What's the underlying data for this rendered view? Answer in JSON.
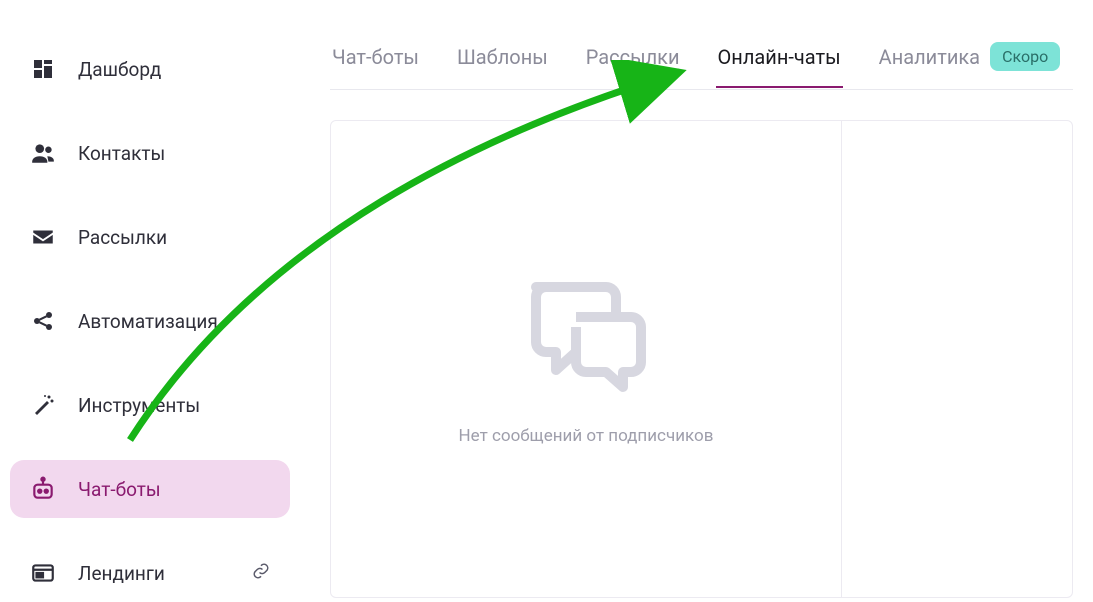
{
  "sidebar": {
    "items": [
      {
        "label": "Дашборд"
      },
      {
        "label": "Контакты"
      },
      {
        "label": "Рассылки"
      },
      {
        "label": "Автоматизация"
      },
      {
        "label": "Инструменты"
      },
      {
        "label": "Чат-боты"
      },
      {
        "label": "Лендинги"
      }
    ]
  },
  "tabs": [
    {
      "label": "Чат-боты"
    },
    {
      "label": "Шаблоны"
    },
    {
      "label": "Рассылки"
    },
    {
      "label": "Онлайн-чаты"
    },
    {
      "label": "Аналитика",
      "badge": "Скоро"
    }
  ],
  "empty_state": {
    "message": "Нет сообщений от подписчиков"
  }
}
